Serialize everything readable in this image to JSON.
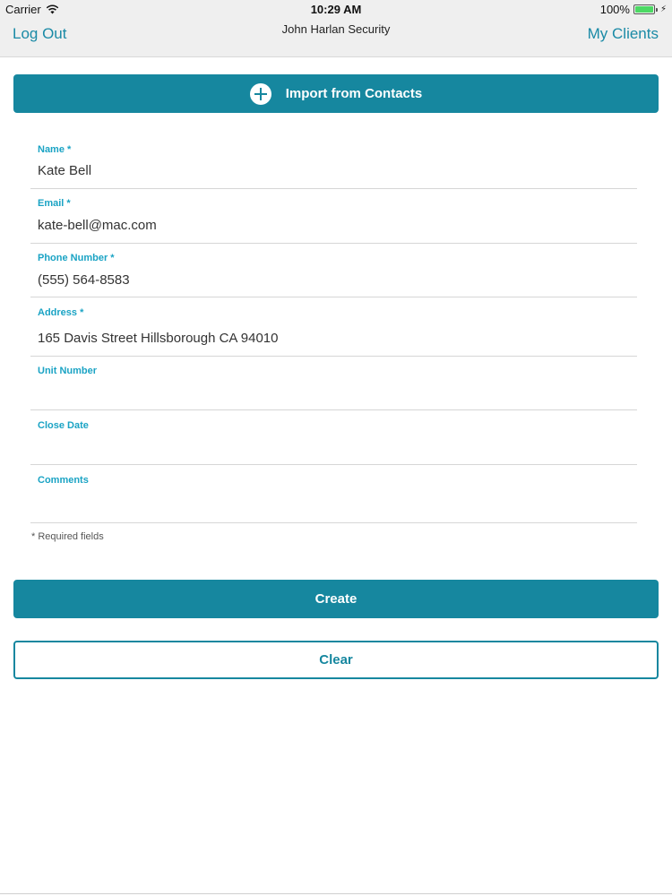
{
  "status_bar": {
    "carrier": "Carrier",
    "time": "10:29 AM",
    "battery": "100%",
    "battery_level": 1.0,
    "icons": [
      "wifi-icon",
      "battery-icon",
      "charging-bolt-icon"
    ]
  },
  "nav": {
    "left_label": "Log Out",
    "title": "John Harlan Security",
    "right_label": "My Clients"
  },
  "import": {
    "label": "Import from Contacts",
    "icon": "plus-circle-icon"
  },
  "form": {
    "fields": [
      {
        "label": "Name *",
        "value": "Kate Bell"
      },
      {
        "label": "Email *",
        "value": "kate-bell@mac.com"
      },
      {
        "label": "Phone Number *",
        "value": "(555) 564-8583"
      },
      {
        "label": "Address *",
        "value": "165 Davis Street Hillsborough CA 94010"
      },
      {
        "label": "Unit Number",
        "value": ""
      },
      {
        "label": "Close Date",
        "value": ""
      },
      {
        "label": "Comments",
        "value": ""
      }
    ],
    "required_note": "* Required fields"
  },
  "actions": {
    "create_label": "Create",
    "clear_label": "Clear"
  },
  "colors": {
    "accent": "#16879f",
    "label": "#1aa3c4",
    "nav_link": "#1a8aa6",
    "bar_background": "#efefef",
    "battery": "#4cd964"
  }
}
